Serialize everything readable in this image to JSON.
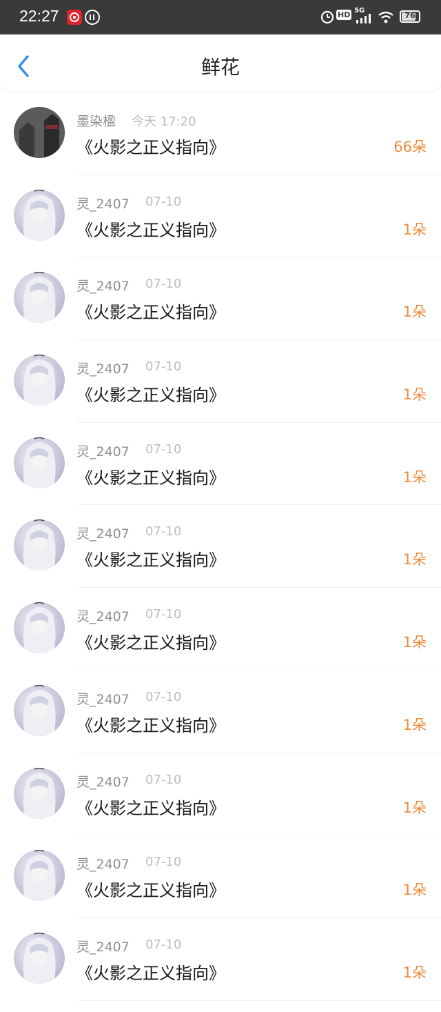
{
  "status_bar": {
    "time": "22:27",
    "network": "5G",
    "hd": "HD",
    "battery": "76"
  },
  "header": {
    "title": "鲜花"
  },
  "gifts": [
    {
      "name": "墨染楹",
      "date": "今天 17:20",
      "work": "《火影之正义指向》",
      "count": "66朵",
      "avatar": "photo"
    },
    {
      "name": "灵_2407",
      "date": "07-10",
      "work": "《火影之正义指向》",
      "count": "1朵",
      "avatar": "anime-girl"
    },
    {
      "name": "灵_2407",
      "date": "07-10",
      "work": "《火影之正义指向》",
      "count": "1朵",
      "avatar": "anime-girl"
    },
    {
      "name": "灵_2407",
      "date": "07-10",
      "work": "《火影之正义指向》",
      "count": "1朵",
      "avatar": "anime-girl"
    },
    {
      "name": "灵_2407",
      "date": "07-10",
      "work": "《火影之正义指向》",
      "count": "1朵",
      "avatar": "anime-girl"
    },
    {
      "name": "灵_2407",
      "date": "07-10",
      "work": "《火影之正义指向》",
      "count": "1朵",
      "avatar": "anime-girl"
    },
    {
      "name": "灵_2407",
      "date": "07-10",
      "work": "《火影之正义指向》",
      "count": "1朵",
      "avatar": "anime-girl"
    },
    {
      "name": "灵_2407",
      "date": "07-10",
      "work": "《火影之正义指向》",
      "count": "1朵",
      "avatar": "anime-girl"
    },
    {
      "name": "灵_2407",
      "date": "07-10",
      "work": "《火影之正义指向》",
      "count": "1朵",
      "avatar": "anime-girl"
    },
    {
      "name": "灵_2407",
      "date": "07-10",
      "work": "《火影之正义指向》",
      "count": "1朵",
      "avatar": "anime-girl"
    },
    {
      "name": "灵_2407",
      "date": "07-10",
      "work": "《火影之正义指向》",
      "count": "1朵",
      "avatar": "anime-girl"
    }
  ],
  "colors": {
    "accent_blue": "#2f8fe8",
    "count_orange": "#f08a3c",
    "status_bar_bg": "#3a3a3a"
  }
}
